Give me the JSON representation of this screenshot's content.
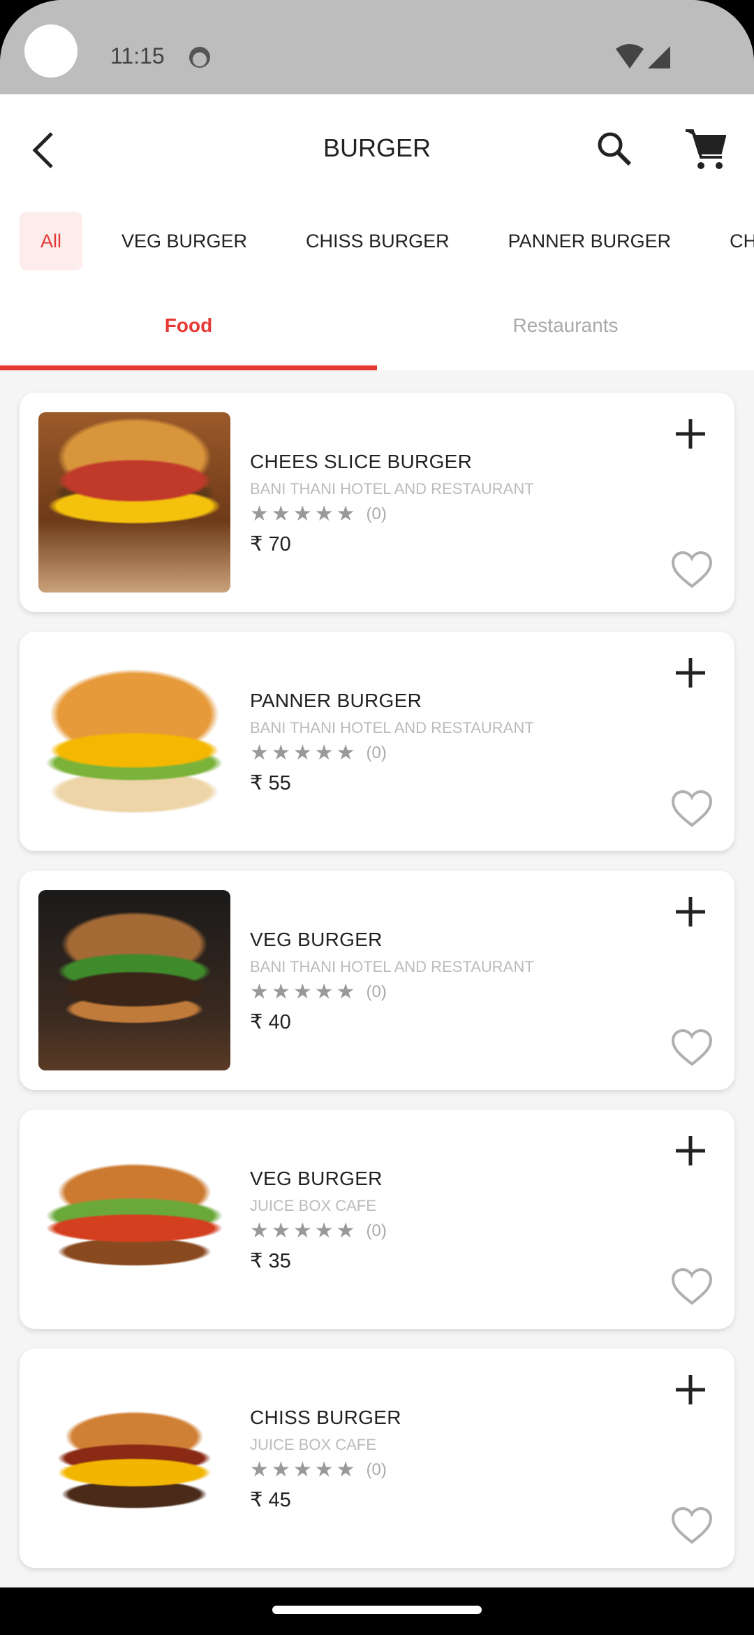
{
  "status_bar": {
    "time": "11:15",
    "icons": [
      "notification-app-icon",
      "wifi-icon",
      "signal-icon"
    ]
  },
  "app_bar": {
    "title": "BURGER",
    "icons": [
      "back-icon",
      "search-icon",
      "cart-icon"
    ]
  },
  "chips": [
    {
      "label": "All",
      "active": true
    },
    {
      "label": "VEG BURGER"
    },
    {
      "label": "CHISS BURGER"
    },
    {
      "label": "PANNER BURGER"
    },
    {
      "label": "CHOW"
    }
  ],
  "tabs": [
    {
      "label": "Food",
      "active": true
    },
    {
      "label": "Restaurants"
    }
  ],
  "colors": {
    "accent": "#e53935",
    "chip_bg": "#fdecec",
    "status_bar": "#bdbdbd"
  },
  "items": [
    {
      "name": "CHEES SLICE BURGER",
      "restaurant": "BANI THANI HOTEL AND RESTAURANT",
      "rating": 0,
      "reviews": "(0)",
      "price": "₹ 70"
    },
    {
      "name": "PANNER BURGER",
      "restaurant": "BANI THANI HOTEL AND RESTAURANT",
      "rating": 0,
      "reviews": "(0)",
      "price": "₹ 55"
    },
    {
      "name": "VEG BURGER",
      "restaurant": "BANI THANI HOTEL AND RESTAURANT",
      "rating": 0,
      "reviews": "(0)",
      "price": "₹ 40"
    },
    {
      "name": "VEG BURGER",
      "restaurant": "JUICE BOX CAFE",
      "rating": 0,
      "reviews": "(0)",
      "price": "₹ 35"
    },
    {
      "name": "CHISS BURGER",
      "restaurant": "JUICE BOX CAFE",
      "rating": 0,
      "reviews": "(0)",
      "price": "₹ 45"
    }
  ]
}
